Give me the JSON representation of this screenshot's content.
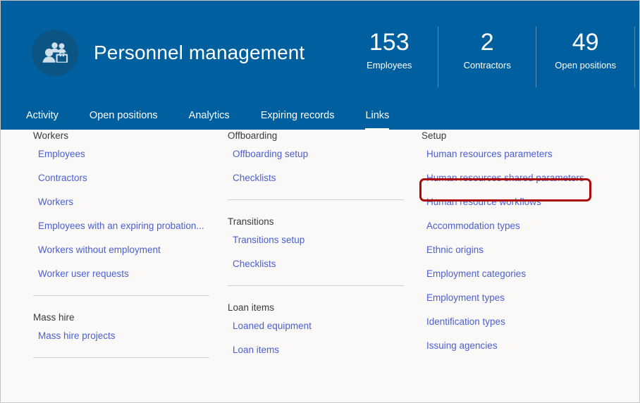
{
  "header": {
    "title": "Personnel management",
    "icon": "people-briefcase-icon",
    "accent_color": "#005f9e",
    "icon_circle_color": "#0b5584",
    "stats": [
      {
        "value": "153",
        "label": "Employees"
      },
      {
        "value": "2",
        "label": "Contractors"
      },
      {
        "value": "49",
        "label": "Open positions"
      }
    ],
    "tabs": [
      {
        "label": "Activity",
        "active": false
      },
      {
        "label": "Open positions",
        "active": false
      },
      {
        "label": "Analytics",
        "active": false
      },
      {
        "label": "Expiring records",
        "active": false
      },
      {
        "label": "Links",
        "active": true
      }
    ]
  },
  "link_color": "#4a5fd0",
  "highlight": {
    "target_label": "Human resources parameters",
    "color": "#ab0a0a"
  },
  "columns": [
    {
      "groups": [
        {
          "title": "Workers",
          "links": [
            "Employees",
            "Contractors",
            "Workers",
            "Employees with an expiring probation...",
            "Workers without employment",
            "Worker user requests"
          ]
        },
        {
          "title": "Mass hire",
          "links": [
            "Mass hire projects"
          ]
        }
      ]
    },
    {
      "groups": [
        {
          "title": "Offboarding",
          "links": [
            "Offboarding setup",
            "Checklists"
          ]
        },
        {
          "title": "Transitions",
          "links": [
            "Transitions setup",
            "Checklists"
          ]
        },
        {
          "title": "Loan items",
          "links": [
            "Loaned equipment",
            "Loan items"
          ]
        }
      ]
    },
    {
      "groups": [
        {
          "title": "Setup",
          "links": [
            "Human resources parameters",
            "Human resources shared parameters",
            "Human resource workflows",
            "Accommodation types",
            "Ethnic origins",
            "Employment categories",
            "Employment types",
            "Identification types",
            "Issuing agencies"
          ]
        }
      ]
    }
  ]
}
